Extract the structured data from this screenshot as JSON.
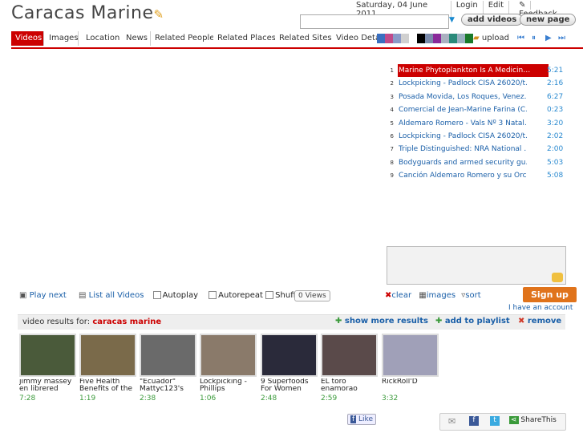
{
  "header": {
    "title": "Caracas Marine",
    "date": "Saturday, 04 June 2011",
    "links": [
      "Login",
      "Edit",
      "Feedback"
    ],
    "add_videos": "add videos",
    "new_page": "new page",
    "search_value": ""
  },
  "tabs": [
    "Videos",
    "Images",
    "Location",
    "News",
    "Related People",
    "Related Places",
    "Related Sites",
    "Video Deta"
  ],
  "toolbar": {
    "upload": "upload",
    "swatch_colors": [
      "#3a6fc0",
      "#c04a8a",
      "#8a9ac8",
      "#d0d0d0",
      "#ffffff",
      "#000000",
      "#7a8aaa",
      "#8a2a9a",
      "#aab0c0",
      "#2a8a7a",
      "#9ab0c0",
      "#1a7a2a"
    ]
  },
  "playlist": [
    {
      "num": "1",
      "title": "Marine Phytoplankton Is A Medicin…",
      "dur": "5:21",
      "selected": true
    },
    {
      "num": "2",
      "title": "Lockpicking - Padlock CISA 26020/t…",
      "dur": "2:16"
    },
    {
      "num": "3",
      "title": "Posada Movida, Los Roques, Venez…",
      "dur": "6:27"
    },
    {
      "num": "4",
      "title": "Comercial de Jean-Marine Farina (C…",
      "dur": "0:23"
    },
    {
      "num": "5",
      "title": "Aldemaro Romero - Vals Nº 3 Natal…",
      "dur": "3:20"
    },
    {
      "num": "6",
      "title": "Lockpicking - Padlock CISA 26020/t…",
      "dur": "2:02"
    },
    {
      "num": "7",
      "title": "Triple Distinguished: NRA National …",
      "dur": "2:00"
    },
    {
      "num": "8",
      "title": "Bodyguards and armed security gu…",
      "dur": "5:03"
    },
    {
      "num": "9",
      "title": "Canción Aldemaro Romero y su Orc…",
      "dur": "5:08"
    }
  ],
  "controls": {
    "play_next": "Play next",
    "list_all": "List all Videos",
    "autoplay": "Autoplay",
    "autorepeat": "Autorepeat",
    "shuffle": "Shuffle",
    "views": "0 Views",
    "clear": "clear",
    "images": "images",
    "sort": "sort",
    "signup": "Sign up",
    "have_account": "I have an account"
  },
  "results": {
    "label": "video results for:",
    "query": "caracas marine",
    "show_more": "show more results",
    "add_playlist": "add to playlist",
    "remove": "remove",
    "videos": [
      {
        "title": "jimmy massey en librered",
        "dur": "7:28",
        "color": "#4a5a3a"
      },
      {
        "title": "Five Health Benefits of the",
        "dur": "1:19",
        "color": "#7a6a4a"
      },
      {
        "title": "\"Ecuador\" Mattyc123's",
        "dur": "2:38",
        "color": "#6a6a6a"
      },
      {
        "title": "Lockpicking - Phillips",
        "dur": "1:06",
        "color": "#8a7a6a"
      },
      {
        "title": "9 Superfoods For Women",
        "dur": "2:48",
        "color": "#2a2a3a"
      },
      {
        "title": "EL toro enamorao",
        "dur": "2:59",
        "color": "#5a4a4a"
      },
      {
        "title": "RickRoll'D",
        "dur": "3:32",
        "color": "#a0a0b8"
      }
    ]
  },
  "social": {
    "like": "Like",
    "share": "ShareThis"
  }
}
